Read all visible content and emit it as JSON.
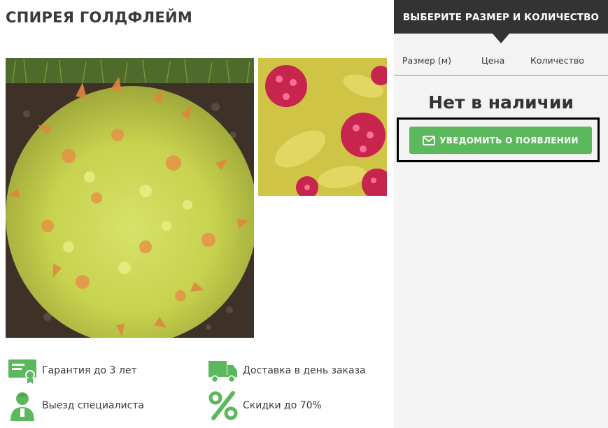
{
  "product": {
    "title": "СПИРЕЯ ГОЛДФЛЕЙМ"
  },
  "gallery": {
    "main_image_subject": "spirea-goldflame-shrub",
    "thumbnail_subject": "spirea-pink-flowers"
  },
  "features": [
    {
      "icon": "certificate-icon",
      "label": "Гарантия до 3 лет"
    },
    {
      "icon": "delivery-truck-icon",
      "label": "Доставка в день заказа"
    },
    {
      "icon": "specialist-icon",
      "label": "Выезд специалиста"
    },
    {
      "icon": "percent-icon",
      "label": "Скидки до 70%"
    }
  ],
  "order_panel": {
    "header": "ВЫБЕРИТЕ РАЗМЕР И КОЛИЧЕСТВО",
    "columns": [
      "Размер (м)",
      "Цена",
      "Количество"
    ],
    "stock_status": "Нет в наличии",
    "notify_button": "УВЕДОМИТЬ О ПОЯВЛЕНИИ"
  },
  "colors": {
    "accent_green": "#5cb85c",
    "header_dark": "#333333",
    "icon_green": "#5cb85c",
    "panel_bg": "#f3f3f3"
  }
}
